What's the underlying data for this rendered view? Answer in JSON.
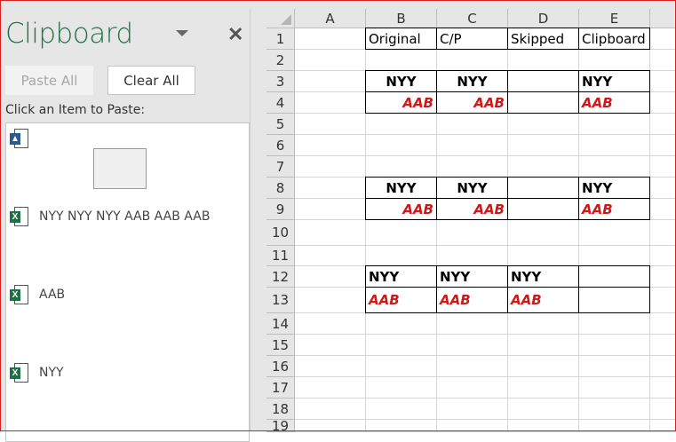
{
  "pane": {
    "title": "Clipboard",
    "paste_all": "Paste All",
    "clear_all": "Clear All",
    "hint": "Click an Item to Paste:",
    "items": [
      {
        "type": "image",
        "text": ""
      },
      {
        "type": "excel",
        "text": "NYY NYY NYY AAB AAB AAB"
      },
      {
        "type": "excel",
        "text": "AAB"
      },
      {
        "type": "excel",
        "text": "NYY"
      }
    ]
  },
  "sheet": {
    "columns": [
      "A",
      "B",
      "C",
      "D",
      "E"
    ],
    "rows": [
      "1",
      "2",
      "3",
      "4",
      "5",
      "6",
      "7",
      "8",
      "9",
      "10",
      "11",
      "12",
      "13",
      "14",
      "15",
      "16",
      "17",
      "18",
      "19"
    ],
    "cells": {
      "B1": "Original",
      "C1": "C/P",
      "D1": "Skipped",
      "E1": "Clipboard",
      "B3": "NYY",
      "C3": "NYY",
      "E3": "NYY",
      "B4": "AAB",
      "C4": "AAB",
      "E4": "AAB",
      "B8": "NYY",
      "C8": "NYY",
      "E8": "NYY",
      "B9": "AAB",
      "C9": "AAB",
      "E9": "AAB",
      "B12": "NYY",
      "C12": "NYY",
      "D12": "NYY",
      "B13": "AAB",
      "C13": "AAB",
      "D13": "AAB"
    }
  },
  "colors": {
    "accent": "#217346",
    "red_text": "#d01818"
  }
}
